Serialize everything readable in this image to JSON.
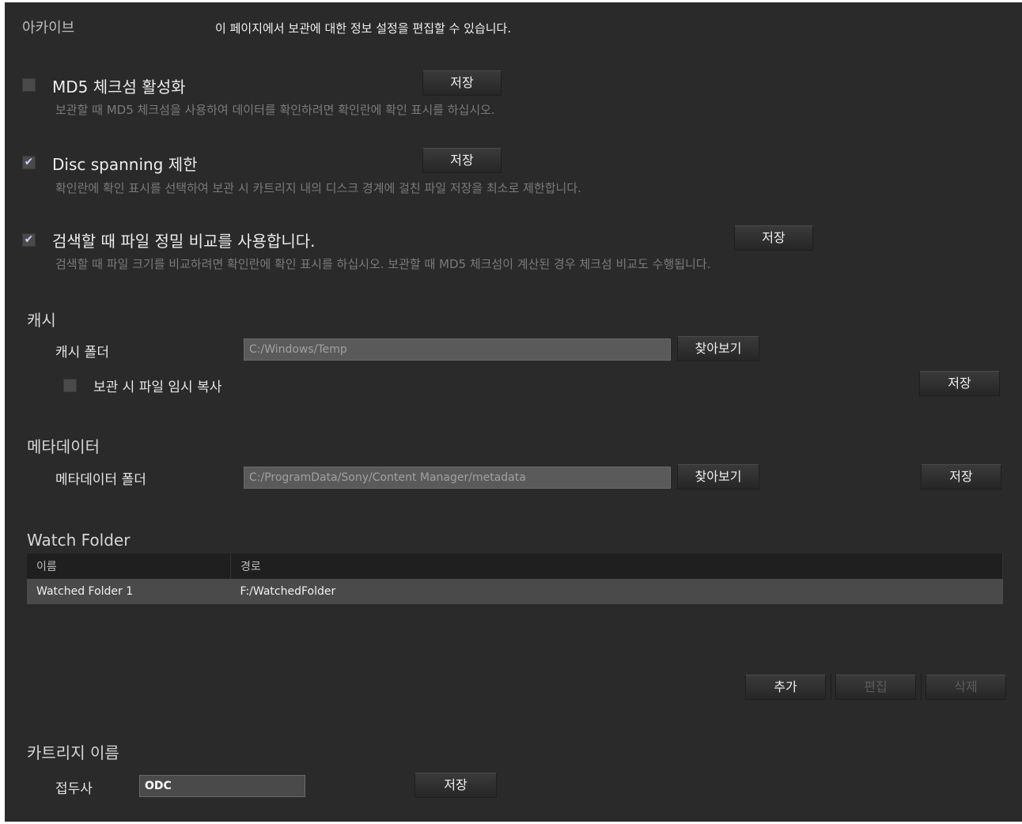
{
  "header": {
    "title": "아카이브",
    "description": "이 페이지에서 보관에 대한 정보 설정을 편집할 수 있습니다."
  },
  "options": [
    {
      "label": "MD5 체크섬 활성화",
      "checked": false,
      "description": "보관할 때 MD5 체크섬을 사용하여 데이터를 확인하려면 확인란에 확인 표시를 하십시오.",
      "save_label": "저장"
    },
    {
      "label": "Disc spanning 제한",
      "checked": true,
      "description": "확인란에 확인 표시를 선택하여 보관 시 카트리지 내의 디스크 경계에 걸친 파일 저장을 최소로 제한합니다.",
      "save_label": "저장"
    },
    {
      "label": "검색할 때 파일 정밀 비교를 사용합니다.",
      "checked": true,
      "description": "검색할 때 파일 크기를 비교하려면 확인란에 확인 표시를 하십시오. 보관할 때 MD5 체크섬이 계산된 경우 체크섬 비교도 수행됩니다.",
      "save_label": "저장"
    }
  ],
  "cache": {
    "title": "캐시",
    "folder_label": "캐시 폴더",
    "folder_value": "C:/Windows/Temp",
    "browse_label": "찾아보기",
    "temp_copy_label": "보관 시 파일 임시 복사",
    "temp_copy_checked": false,
    "save_label": "저장"
  },
  "metadata": {
    "title": "메타데이터",
    "folder_label": "메타데이터 폴더",
    "folder_value": "C:/ProgramData/Sony/Content Manager/metadata",
    "browse_label": "찾아보기",
    "save_label": "저장"
  },
  "watch_folder": {
    "title": "Watch Folder",
    "columns": [
      "이름",
      "경로"
    ],
    "rows": [
      {
        "name": "Watched Folder 1",
        "path": "F:/WatchedFolder"
      }
    ],
    "add_label": "추가",
    "edit_label": "편집",
    "delete_label": "삭제"
  },
  "cartridge": {
    "title": "카트리지 이름",
    "prefix_label": "접두사",
    "prefix_value": "ODC",
    "save_label": "저장"
  },
  "colors": {
    "panel_bg": "#2a2a2a",
    "field_bg": "#5a5a5a",
    "check_color": "#c9d2ff"
  }
}
